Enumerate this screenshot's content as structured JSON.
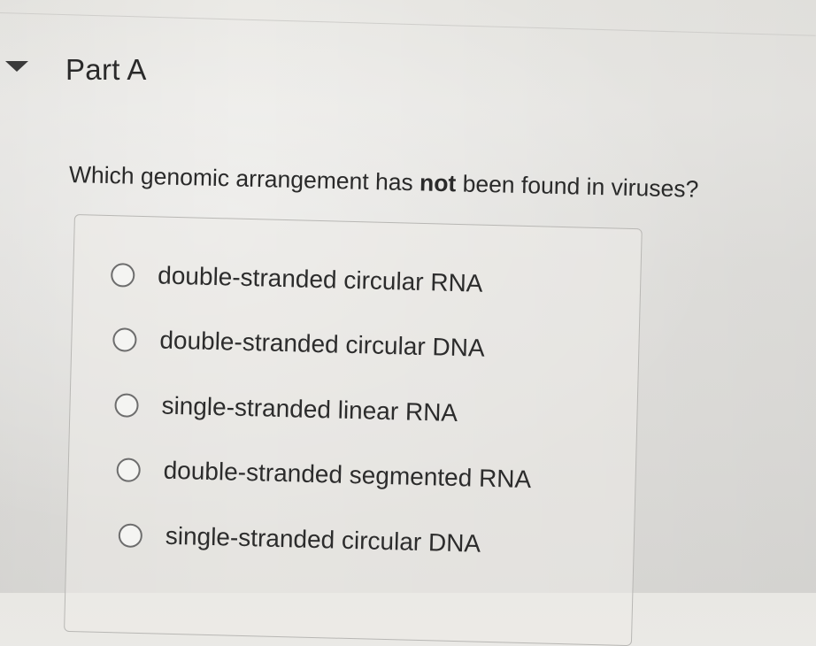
{
  "part": {
    "title": "Part A",
    "caret_icon": "triangle-down-icon"
  },
  "question": {
    "prefix": "Which genomic arrangement has ",
    "emphasis": "not",
    "suffix": " been found in viruses?"
  },
  "options": [
    {
      "label": "double-stranded circular RNA",
      "selected": false
    },
    {
      "label": "double-stranded circular DNA",
      "selected": false
    },
    {
      "label": "single-stranded linear RNA",
      "selected": false
    },
    {
      "label": "double-stranded segmented RNA",
      "selected": false
    },
    {
      "label": "single-stranded circular DNA",
      "selected": false
    }
  ]
}
